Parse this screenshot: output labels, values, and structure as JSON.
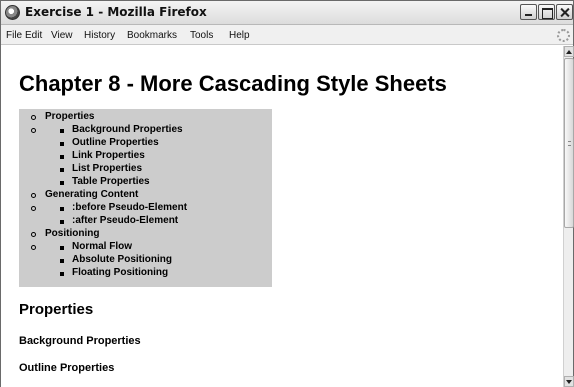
{
  "window": {
    "title": "Exercise 1 - Mozilla Firefox"
  },
  "menubar": {
    "items": [
      "File",
      "Edit",
      "View",
      "History",
      "Bookmarks",
      "Tools",
      "Help"
    ]
  },
  "page": {
    "title": "Chapter 8 - More Cascading Style Sheets",
    "toc": [
      {
        "label": "Properties",
        "level": 1,
        "bullet": "circle"
      },
      {
        "label": "",
        "level": 1,
        "bullet": "circle"
      },
      {
        "label": "Background Properties",
        "level": 2,
        "bullet": "square"
      },
      {
        "label": "Outline Properties",
        "level": 2,
        "bullet": "square"
      },
      {
        "label": "Link Properties",
        "level": 2,
        "bullet": "square"
      },
      {
        "label": "List Properties",
        "level": 2,
        "bullet": "square"
      },
      {
        "label": "Table Properties",
        "level": 2,
        "bullet": "square"
      },
      {
        "label": "Generating Content",
        "level": 1,
        "bullet": "circle"
      },
      {
        "label": "",
        "level": 1,
        "bullet": "circle"
      },
      {
        "label": ":before Pseudo-Element",
        "level": 2,
        "bullet": "square"
      },
      {
        "label": ":after Pseudo-Element",
        "level": 2,
        "bullet": "square"
      },
      {
        "label": "Positioning",
        "level": 1,
        "bullet": "circle"
      },
      {
        "label": "",
        "level": 1,
        "bullet": "circle"
      },
      {
        "label": "Normal Flow",
        "level": 2,
        "bullet": "square"
      },
      {
        "label": "Absolute Positioning",
        "level": 2,
        "bullet": "square"
      },
      {
        "label": "Floating Positioning",
        "level": 2,
        "bullet": "square"
      }
    ],
    "section_heading": "Properties",
    "subheadings": [
      "Background Properties",
      "Outline Properties"
    ]
  },
  "colors": {
    "toc_background": "#cccccc",
    "page_background": "#ffffff",
    "text": "#000000"
  }
}
